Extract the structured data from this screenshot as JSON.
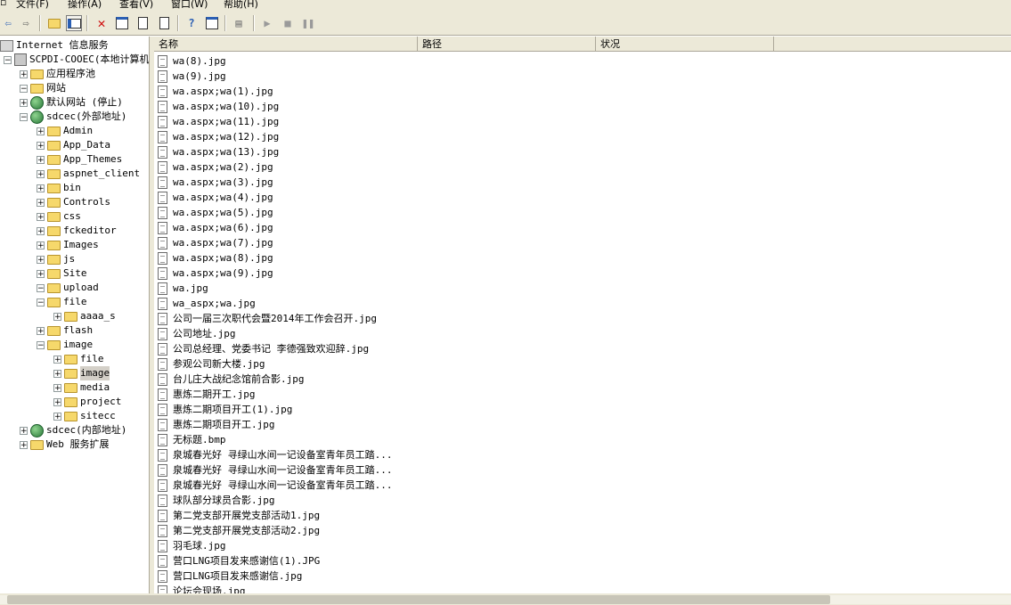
{
  "menu": [
    "文件(F)",
    "操作(A)",
    "查看(V)",
    "窗口(W)",
    "帮助(H)"
  ],
  "toolbar_icons": [
    "back-arrow-icon",
    "forward-arrow-icon",
    "up-folder-icon",
    "show-hide-tree-icon",
    "delete-icon",
    "properties-icon",
    "refresh-icon",
    "export-list-icon",
    "help-icon",
    "console-window-icon",
    "server-icon",
    "play-icon",
    "stop-icon",
    "pause-icon"
  ],
  "tree": [
    {
      "label": "Internet 信息服务",
      "expander": "",
      "icon": "iis",
      "level": 0
    },
    {
      "label": "SCPDI-COOEC(本地计算机)",
      "expander": "-",
      "icon": "server",
      "level": 1
    },
    {
      "label": "应用程序池",
      "expander": "+",
      "icon": "folder",
      "level": 2
    },
    {
      "label": "网站",
      "expander": "-",
      "icon": "folder",
      "level": 2
    },
    {
      "label": "默认网站 (停止)",
      "expander": "+",
      "icon": "globe",
      "level": 3
    },
    {
      "label": "sdcec(外部地址)",
      "expander": "-",
      "icon": "globe",
      "level": 3
    },
    {
      "label": "Admin",
      "expander": "+",
      "icon": "folder",
      "level": 4
    },
    {
      "label": "App_Data",
      "expander": "+",
      "icon": "folder",
      "level": 4
    },
    {
      "label": "App_Themes",
      "expander": "+",
      "icon": "folder",
      "level": 4
    },
    {
      "label": "aspnet_client",
      "expander": "+",
      "icon": "folder",
      "level": 4
    },
    {
      "label": "bin",
      "expander": "+",
      "icon": "folder",
      "level": 4
    },
    {
      "label": "Controls",
      "expander": "+",
      "icon": "folder",
      "level": 4
    },
    {
      "label": "css",
      "expander": "+",
      "icon": "folder",
      "level": 4
    },
    {
      "label": "fckeditor",
      "expander": "+",
      "icon": "folder",
      "level": 4
    },
    {
      "label": "Images",
      "expander": "+",
      "icon": "folder",
      "level": 4
    },
    {
      "label": "js",
      "expander": "+",
      "icon": "folder",
      "level": 4
    },
    {
      "label": "Site",
      "expander": "+",
      "icon": "folder",
      "level": 4
    },
    {
      "label": "upload",
      "expander": "-",
      "icon": "folder",
      "level": 4
    },
    {
      "label": "file",
      "expander": "-",
      "icon": "folder",
      "level": 5
    },
    {
      "label": "aaaa_s",
      "expander": "+",
      "icon": "folder",
      "level": 6
    },
    {
      "label": "flash",
      "expander": "+",
      "icon": "folder",
      "level": 5
    },
    {
      "label": "image",
      "expander": "-",
      "icon": "folder",
      "level": 5
    },
    {
      "label": "file",
      "expander": "+",
      "icon": "folder",
      "level": 6
    },
    {
      "label": "image",
      "expander": "+",
      "icon": "folder",
      "level": 6,
      "selected": true
    },
    {
      "label": "media",
      "expander": "+",
      "icon": "folder",
      "level": 6
    },
    {
      "label": "project",
      "expander": "+",
      "icon": "folder",
      "level": 6
    },
    {
      "label": "sitecc",
      "expander": "+",
      "icon": "folder",
      "level": 6
    },
    {
      "label": "sdcec(内部地址)",
      "expander": "+",
      "icon": "globe",
      "level": 3
    },
    {
      "label": "Web 服务扩展",
      "expander": "+",
      "icon": "folder",
      "level": 2
    }
  ],
  "columns": [
    "名称",
    "路径",
    "状况"
  ],
  "files": [
    "wa(8).jpg",
    "wa(9).jpg",
    "wa.aspx;wa(1).jpg",
    "wa.aspx;wa(10).jpg",
    "wa.aspx;wa(11).jpg",
    "wa.aspx;wa(12).jpg",
    "wa.aspx;wa(13).jpg",
    "wa.aspx;wa(2).jpg",
    "wa.aspx;wa(3).jpg",
    "wa.aspx;wa(4).jpg",
    "wa.aspx;wa(5).jpg",
    "wa.aspx;wa(6).jpg",
    "wa.aspx;wa(7).jpg",
    "wa.aspx;wa(8).jpg",
    "wa.aspx;wa(9).jpg",
    "wa.jpg",
    "wa_aspx;wa.jpg",
    "公司一届三次职代会暨2014年工作会召开.jpg",
    "公司地址.jpg",
    "公司总经理、党委书记 李德强致欢迎辞.jpg",
    "参观公司新大楼.jpg",
    "台儿庄大战纪念馆前合影.jpg",
    "惠炼二期开工.jpg",
    "惠炼二期项目开工(1).jpg",
    "惠炼二期项目开工.jpg",
    "无标题.bmp",
    "泉城春光好 寻绿山水间一记设备室青年员工踏...",
    "泉城春光好 寻绿山水间一记设备室青年员工踏...",
    "泉城春光好 寻绿山水间一记设备室青年员工踏...",
    "球队部分球员合影.jpg",
    "第二党支部开展党支部活动1.jpg",
    "第二党支部开展党支部活动2.jpg",
    "羽毛球.jpg",
    "营口LNG项目发来感谢信(1).JPG",
    "营口LNG项目发来感谢信.jpg",
    "论坛会现场.jpg"
  ]
}
